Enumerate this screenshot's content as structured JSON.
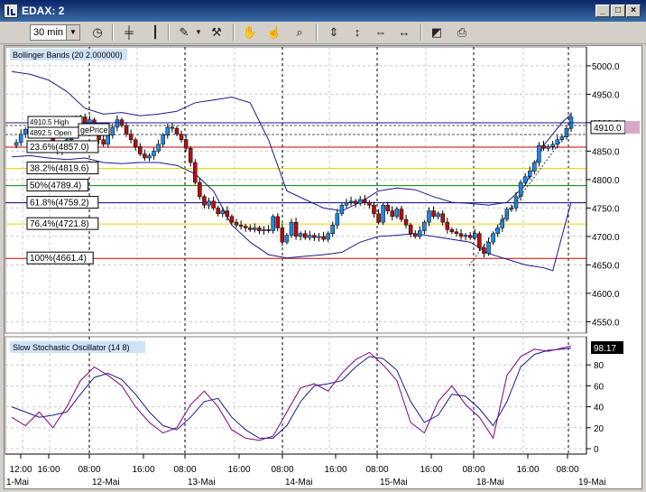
{
  "window": {
    "title": "EDAX: 2",
    "minimize": "_",
    "maximize": "□",
    "close": "×"
  },
  "toolbar": {
    "timeframe": "30 min",
    "icons": [
      "clock-icon",
      "bar-chart-icon",
      "candlestick-icon",
      "pencil-icon",
      "tools-icon",
      "hand-icon",
      "hand-zoom-icon",
      "magnifier-icon",
      "compress-vertical-icon",
      "expand-vertical-icon",
      "compress-horizontal-icon",
      "expand-horizontal-icon",
      "chart-window-icon",
      "printer-icon"
    ]
  },
  "price_panel": {
    "label": "Bollinger Bands (20 2.000000)",
    "ytick_labels": [
      "5000.0",
      "4950.0",
      "4900.0",
      "4850.0",
      "4800.0",
      "4750.0",
      "4700.0",
      "4650.0",
      "4600.0",
      "4550.0"
    ],
    "current_price": "4910.0",
    "fib_levels": [
      {
        "label": "23.6%(4857.0)",
        "value": 4857.0,
        "color": "#cc0000"
      },
      {
        "label": "38.2%(4819.6)",
        "value": 4819.6,
        "color": "#e6d800"
      },
      {
        "label": "50%(4789.4)",
        "value": 4789.4,
        "color": "#008800"
      },
      {
        "label": "61.8%(4759.2)",
        "value": 4759.2,
        "color": "#000080"
      },
      {
        "label": "76.4%(4721.8)",
        "value": 4721.8,
        "color": "#e6d800"
      },
      {
        "label": "100%(4661.4)",
        "value": 4661.4,
        "color": "#cc0000"
      }
    ],
    "price_tags": [
      "4910.5 High",
      "4892.5 Open"
    ],
    "partial_label": "gePrice"
  },
  "stoch_panel": {
    "label": "Slow Stochastic Oscillator (14 8)",
    "ytick_labels": [
      "80",
      "60",
      "40",
      "20",
      "0"
    ],
    "current_value": "98.17"
  },
  "xaxis": {
    "times": [
      "12:00",
      "16:00",
      "08:00",
      "16:00",
      "08:00",
      "16:00",
      "08:00",
      "16:00",
      "08:00",
      "16:00",
      "08:00",
      "16:00",
      "08:00"
    ],
    "dates": [
      "1-Mai",
      "12-Mai",
      "13-Mai",
      "14-Mai",
      "15-Mai",
      "18-Mai",
      "19-Mai"
    ]
  },
  "colors": {
    "up_candle": "#1e88e5",
    "down_candle": "#b01010",
    "band": "#1a1a8c",
    "stoch_k": "#800080",
    "stoch_d": "#1a1a8c"
  },
  "chart_data": {
    "type": "candlestick",
    "ylim": [
      4530,
      5030
    ],
    "close_path": [
      [
        0,
        4860
      ],
      [
        1,
        4865
      ],
      [
        2,
        4880
      ],
      [
        3,
        4888
      ],
      [
        4,
        4900
      ],
      [
        5,
        4893
      ],
      [
        6,
        4895
      ],
      [
        7,
        4888
      ],
      [
        8,
        4880
      ],
      [
        9,
        4860
      ],
      [
        10,
        4850
      ],
      [
        11,
        4858
      ],
      [
        12,
        4870
      ],
      [
        13,
        4885
      ],
      [
        14,
        4905
      ],
      [
        15,
        4910
      ],
      [
        16,
        4898
      ],
      [
        17,
        4905
      ],
      [
        18,
        4890
      ],
      [
        19,
        4870
      ],
      [
        20,
        4862
      ],
      [
        21,
        4878
      ],
      [
        22,
        4892
      ],
      [
        23,
        4905
      ],
      [
        24,
        4895
      ],
      [
        25,
        4880
      ],
      [
        26,
        4870
      ],
      [
        27,
        4858
      ],
      [
        28,
        4845
      ],
      [
        29,
        4838
      ],
      [
        30,
        4842
      ],
      [
        31,
        4850
      ],
      [
        32,
        4862
      ],
      [
        33,
        4878
      ],
      [
        34,
        4892
      ],
      [
        35,
        4890
      ],
      [
        36,
        4880
      ],
      [
        37,
        4870
      ],
      [
        38,
        4855
      ],
      [
        39,
        4830
      ],
      [
        40,
        4795
      ],
      [
        41,
        4770
      ],
      [
        42,
        4755
      ],
      [
        43,
        4762
      ],
      [
        44,
        4750
      ],
      [
        45,
        4740
      ],
      [
        46,
        4745
      ],
      [
        47,
        4735
      ],
      [
        48,
        4725
      ],
      [
        49,
        4720
      ],
      [
        50,
        4718
      ],
      [
        51,
        4715
      ],
      [
        52,
        4712
      ],
      [
        53,
        4715
      ],
      [
        54,
        4710
      ],
      [
        55,
        4712
      ],
      [
        56,
        4710
      ],
      [
        57,
        4735
      ],
      [
        58,
        4715
      ],
      [
        59,
        4690
      ],
      [
        60,
        4702
      ],
      [
        61,
        4725
      ],
      [
        62,
        4700
      ],
      [
        63,
        4705
      ],
      [
        64,
        4698
      ],
      [
        65,
        4702
      ],
      [
        66,
        4698
      ],
      [
        67,
        4700
      ],
      [
        68,
        4695
      ],
      [
        69,
        4705
      ],
      [
        70,
        4720
      ],
      [
        71,
        4740
      ],
      [
        72,
        4755
      ],
      [
        73,
        4760
      ],
      [
        74,
        4762
      ],
      [
        75,
        4758
      ],
      [
        76,
        4765
      ],
      [
        77,
        4760
      ],
      [
        78,
        4755
      ],
      [
        79,
        4740
      ],
      [
        80,
        4725
      ],
      [
        81,
        4755
      ],
      [
        82,
        4745
      ],
      [
        83,
        4735
      ],
      [
        84,
        4748
      ],
      [
        85,
        4730
      ],
      [
        86,
        4720
      ],
      [
        87,
        4705
      ],
      [
        88,
        4700
      ],
      [
        89,
        4710
      ],
      [
        90,
        4725
      ],
      [
        91,
        4745
      ],
      [
        92,
        4735
      ],
      [
        93,
        4740
      ],
      [
        94,
        4725
      ],
      [
        95,
        4712
      ],
      [
        96,
        4708
      ],
      [
        97,
        4705
      ],
      [
        98,
        4700
      ],
      [
        99,
        4702
      ],
      [
        100,
        4698
      ],
      [
        101,
        4705
      ],
      [
        102,
        4680
      ],
      [
        103,
        4670
      ],
      [
        104,
        4690
      ],
      [
        105,
        4705
      ],
      [
        106,
        4715
      ],
      [
        107,
        4730
      ],
      [
        108,
        4748
      ],
      [
        109,
        4750
      ],
      [
        110,
        4770
      ],
      [
        111,
        4795
      ],
      [
        112,
        4805
      ],
      [
        113,
        4815
      ],
      [
        114,
        4830
      ],
      [
        115,
        4860
      ],
      [
        116,
        4855
      ],
      [
        117,
        4858
      ],
      [
        118,
        4862
      ],
      [
        119,
        4870
      ],
      [
        120,
        4875
      ],
      [
        121,
        4890
      ],
      [
        122,
        4910
      ]
    ],
    "upper_band": [
      [
        0,
        4990
      ],
      [
        4,
        4985
      ],
      [
        8,
        4975
      ],
      [
        12,
        4955
      ],
      [
        16,
        4925
      ],
      [
        20,
        4915
      ],
      [
        24,
        4918
      ],
      [
        28,
        4912
      ],
      [
        32,
        4915
      ],
      [
        36,
        4920
      ],
      [
        40,
        4935
      ],
      [
        44,
        4940
      ],
      [
        48,
        4945
      ],
      [
        52,
        4935
      ],
      [
        56,
        4870
      ],
      [
        60,
        4780
      ],
      [
        64,
        4765
      ],
      [
        68,
        4750
      ],
      [
        72,
        4745
      ],
      [
        76,
        4760
      ],
      [
        80,
        4780
      ],
      [
        84,
        4785
      ],
      [
        88,
        4782
      ],
      [
        92,
        4770
      ],
      [
        96,
        4760
      ],
      [
        100,
        4758
      ],
      [
        104,
        4755
      ],
      [
        108,
        4760
      ],
      [
        112,
        4790
      ],
      [
        116,
        4860
      ],
      [
        120,
        4900
      ],
      [
        122,
        4915
      ]
    ],
    "lower_band": [
      [
        0,
        4840
      ],
      [
        4,
        4842
      ],
      [
        8,
        4838
      ],
      [
        12,
        4835
      ],
      [
        16,
        4838
      ],
      [
        20,
        4830
      ],
      [
        24,
        4828
      ],
      [
        28,
        4830
      ],
      [
        32,
        4830
      ],
      [
        36,
        4825
      ],
      [
        40,
        4810
      ],
      [
        44,
        4780
      ],
      [
        48,
        4720
      ],
      [
        52,
        4690
      ],
      [
        56,
        4668
      ],
      [
        60,
        4662
      ],
      [
        64,
        4665
      ],
      [
        68,
        4668
      ],
      [
        72,
        4672
      ],
      [
        76,
        4690
      ],
      [
        80,
        4700
      ],
      [
        84,
        4702
      ],
      [
        88,
        4705
      ],
      [
        92,
        4700
      ],
      [
        96,
        4695
      ],
      [
        100,
        4690
      ],
      [
        104,
        4670
      ],
      [
        108,
        4660
      ],
      [
        112,
        4650
      ],
      [
        116,
        4645
      ],
      [
        118,
        4640
      ],
      [
        120,
        4700
      ],
      [
        122,
        4760
      ]
    ],
    "stoch_k": [
      [
        0,
        30
      ],
      [
        3,
        22
      ],
      [
        6,
        35
      ],
      [
        9,
        20
      ],
      [
        12,
        40
      ],
      [
        15,
        65
      ],
      [
        18,
        78
      ],
      [
        21,
        70
      ],
      [
        24,
        60
      ],
      [
        27,
        40
      ],
      [
        30,
        25
      ],
      [
        33,
        15
      ],
      [
        36,
        20
      ],
      [
        39,
        42
      ],
      [
        42,
        55
      ],
      [
        45,
        40
      ],
      [
        48,
        18
      ],
      [
        51,
        10
      ],
      [
        54,
        8
      ],
      [
        57,
        12
      ],
      [
        60,
        35
      ],
      [
        63,
        58
      ],
      [
        66,
        62
      ],
      [
        69,
        55
      ],
      [
        72,
        72
      ],
      [
        75,
        85
      ],
      [
        78,
        92
      ],
      [
        81,
        80
      ],
      [
        84,
        65
      ],
      [
        87,
        25
      ],
      [
        90,
        15
      ],
      [
        93,
        45
      ],
      [
        96,
        60
      ],
      [
        99,
        42
      ],
      [
        102,
        30
      ],
      [
        105,
        10
      ],
      [
        108,
        70
      ],
      [
        111,
        88
      ],
      [
        114,
        95
      ],
      [
        117,
        93
      ],
      [
        120,
        96
      ],
      [
        122,
        98
      ]
    ],
    "stoch_d": [
      [
        0,
        40
      ],
      [
        3,
        35
      ],
      [
        6,
        30
      ],
      [
        9,
        32
      ],
      [
        12,
        35
      ],
      [
        15,
        52
      ],
      [
        18,
        68
      ],
      [
        21,
        72
      ],
      [
        24,
        66
      ],
      [
        27,
        52
      ],
      [
        30,
        35
      ],
      [
        33,
        22
      ],
      [
        36,
        18
      ],
      [
        39,
        30
      ],
      [
        42,
        45
      ],
      [
        45,
        48
      ],
      [
        48,
        30
      ],
      [
        51,
        18
      ],
      [
        54,
        10
      ],
      [
        57,
        10
      ],
      [
        60,
        22
      ],
      [
        63,
        45
      ],
      [
        66,
        60
      ],
      [
        69,
        62
      ],
      [
        72,
        65
      ],
      [
        75,
        78
      ],
      [
        78,
        88
      ],
      [
        81,
        86
      ],
      [
        84,
        75
      ],
      [
        87,
        45
      ],
      [
        90,
        25
      ],
      [
        93,
        32
      ],
      [
        96,
        52
      ],
      [
        99,
        50
      ],
      [
        102,
        38
      ],
      [
        105,
        22
      ],
      [
        108,
        45
      ],
      [
        111,
        78
      ],
      [
        114,
        90
      ],
      [
        117,
        94
      ],
      [
        120,
        95
      ],
      [
        122,
        96
      ]
    ]
  }
}
